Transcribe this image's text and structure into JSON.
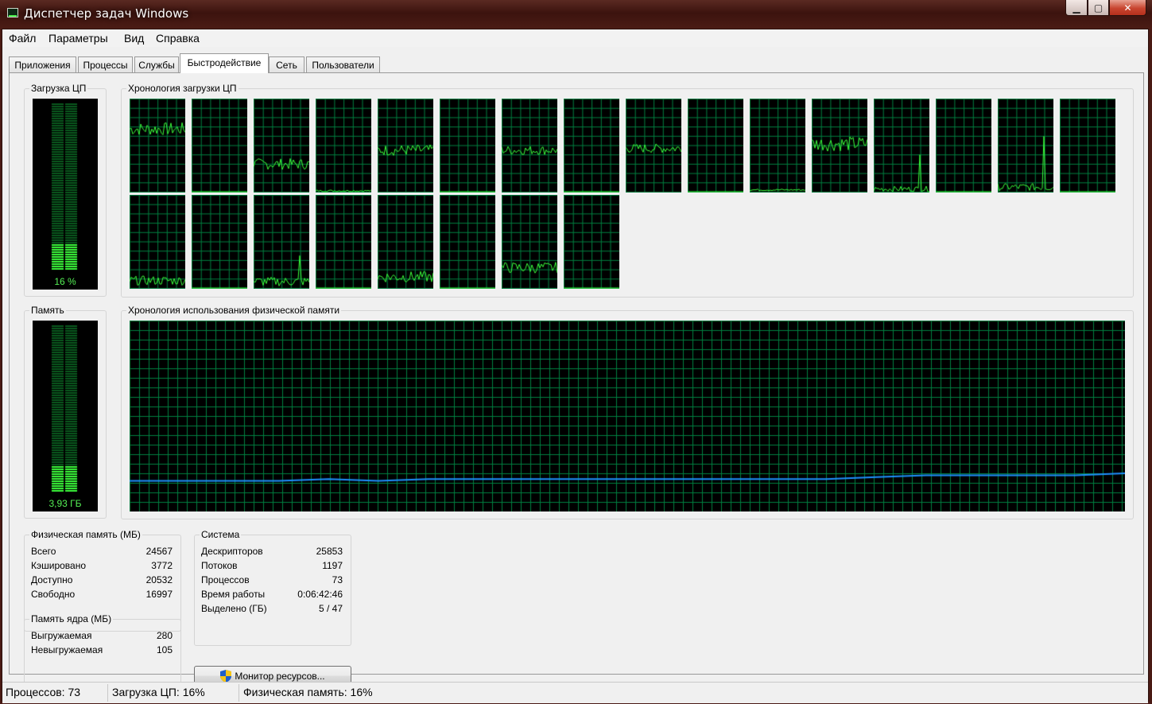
{
  "window": {
    "title": "Диспетчер задач Windows"
  },
  "menu": [
    "Файл",
    "Параметры",
    "Вид",
    "Справка"
  ],
  "tabs": [
    "Приложения",
    "Процессы",
    "Службы",
    "Быстродействие",
    "Сеть",
    "Пользователи"
  ],
  "active_tab": 3,
  "cpu": {
    "group_label": "Загрузка ЦП",
    "value_text": "16 %",
    "percent": 16,
    "history_label": "Хронология загрузки ЦП",
    "cores": [
      {
        "level": 0.68,
        "amp": 0.07
      },
      {
        "level": 0.0,
        "amp": 0.0
      },
      {
        "level": 0.3,
        "amp": 0.06
      },
      {
        "level": 0.01,
        "amp": 0.01
      },
      {
        "level": 0.45,
        "amp": 0.06
      },
      {
        "level": 0.0,
        "amp": 0.0
      },
      {
        "level": 0.45,
        "amp": 0.05
      },
      {
        "level": 0.0,
        "amp": 0.0
      },
      {
        "level": 0.47,
        "amp": 0.05
      },
      {
        "level": 0.0,
        "amp": 0.0
      },
      {
        "level": 0.02,
        "amp": 0.01
      },
      {
        "level": 0.52,
        "amp": 0.08
      },
      {
        "level": 0.03,
        "amp": 0.03,
        "spike": 0.4
      },
      {
        "level": 0.0,
        "amp": 0.0
      },
      {
        "level": 0.05,
        "amp": 0.04,
        "spike": 0.6
      },
      {
        "level": 0.0,
        "amp": 0.0
      },
      {
        "level": 0.08,
        "amp": 0.05
      },
      {
        "level": 0.0,
        "amp": 0.0
      },
      {
        "level": 0.07,
        "amp": 0.05,
        "spike": 0.35
      },
      {
        "level": 0.0,
        "amp": 0.0
      },
      {
        "level": 0.12,
        "amp": 0.06
      },
      {
        "level": 0.0,
        "amp": 0.0
      },
      {
        "level": 0.22,
        "amp": 0.06
      },
      {
        "level": 0.0,
        "amp": 0.0
      }
    ]
  },
  "memory": {
    "group_label": "Память",
    "value_text": "3,93 ГБ",
    "fraction": 0.16,
    "history_label": "Хронология использования физической памяти",
    "history": [
      0.16,
      0.16,
      0.16,
      0.16,
      0.17,
      0.16,
      0.17,
      0.17,
      0.17,
      0.17,
      0.17,
      0.17,
      0.17,
      0.17,
      0.17,
      0.18,
      0.19,
      0.19,
      0.19,
      0.19,
      0.2
    ]
  },
  "phys_mem": {
    "label": "Физическая память (МБ)",
    "rows": [
      {
        "k": "Всего",
        "v": "24567"
      },
      {
        "k": "Кэшировано",
        "v": "3772"
      },
      {
        "k": "Доступно",
        "v": "20532"
      },
      {
        "k": "Свободно",
        "v": "16997"
      }
    ]
  },
  "kernel_mem": {
    "label": "Память ядра (МБ)",
    "rows": [
      {
        "k": "Выгружаемая",
        "v": "280"
      },
      {
        "k": "Невыгружаемая",
        "v": "105"
      }
    ]
  },
  "system": {
    "label": "Система",
    "rows": [
      {
        "k": "Дескрипторов",
        "v": "25853"
      },
      {
        "k": "Потоков",
        "v": "1197"
      },
      {
        "k": "Процессов",
        "v": "73"
      },
      {
        "k": "Время работы",
        "v": "0:06:42:46"
      },
      {
        "k": "Выделено (ГБ)",
        "v": "5 / 47"
      }
    ]
  },
  "resource_monitor_button": "Монитор ресурсов...",
  "statusbar": {
    "processes": "Процессов: 73",
    "cpu": "Загрузка ЦП: 16%",
    "memory": "Физическая память: 16%"
  },
  "icons": {
    "app": "task-manager-icon",
    "button": "uac-shield-icon"
  },
  "colors": {
    "graph_bg": "#000000",
    "grid": "#008040",
    "cpu_line": "#3cff3c",
    "mem_line": "#1e90ff"
  }
}
